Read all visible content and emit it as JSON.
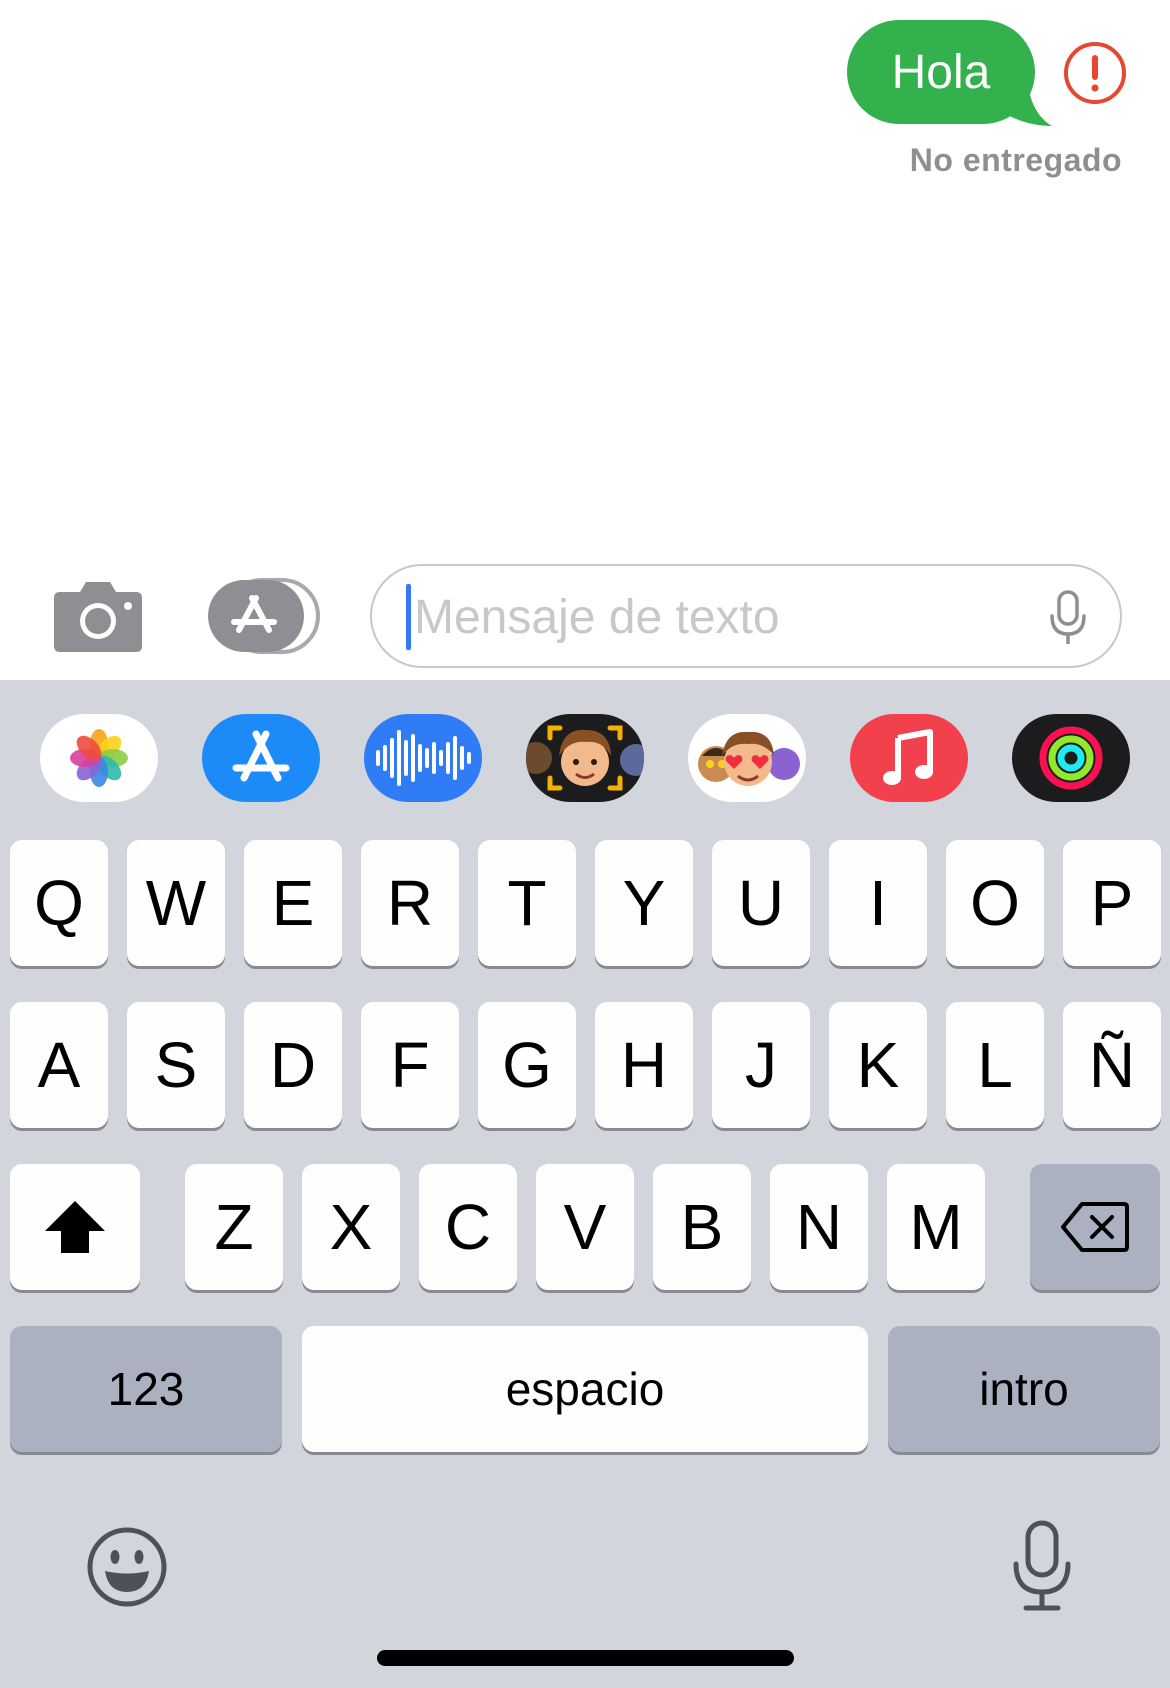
{
  "message": {
    "text": "Hola",
    "status": "No entregado",
    "bubble_color": "#32b14c",
    "error_color": "#e5472f",
    "error_icon": "exclamation-circle-icon"
  },
  "input_bar": {
    "camera_icon": "camera-icon",
    "apps_icon": "app-store-icon",
    "placeholder": "Mensaje de texto",
    "mic_icon": "microphone-icon"
  },
  "app_drawer": [
    {
      "icon": "photos-icon",
      "color": "#ffffff"
    },
    {
      "icon": "app-store-icon",
      "color": "#1c8bf8"
    },
    {
      "icon": "audio-message-icon",
      "color": "#2f7cf6"
    },
    {
      "icon": "memoji-camera-icon",
      "color": "#1c1c1e"
    },
    {
      "icon": "memoji-stickers-icon",
      "color": "#ffffff"
    },
    {
      "icon": "music-icon",
      "color": "#f2404c"
    },
    {
      "icon": "activity-icon",
      "color": "#1c1c1e"
    }
  ],
  "keyboard": {
    "row1": [
      "Q",
      "W",
      "E",
      "R",
      "T",
      "Y",
      "U",
      "I",
      "O",
      "P"
    ],
    "row2": [
      "A",
      "S",
      "D",
      "F",
      "G",
      "H",
      "J",
      "K",
      "L",
      "Ñ"
    ],
    "row3": [
      "Z",
      "X",
      "C",
      "V",
      "B",
      "N",
      "M"
    ],
    "shift_icon": "shift-icon",
    "delete_icon": "delete-backspace-icon",
    "numbers_label": "123",
    "space_label": "espacio",
    "return_label": "intro",
    "emoji_icon": "emoji-icon",
    "dictation_icon": "microphone-icon"
  }
}
